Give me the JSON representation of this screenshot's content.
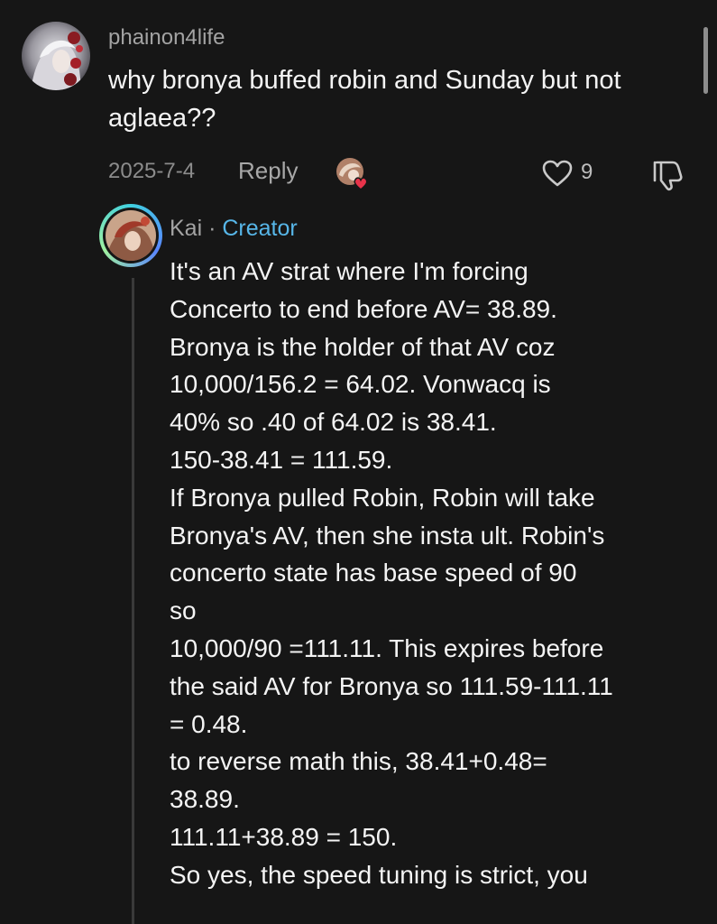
{
  "comment": {
    "username": "phainon4life",
    "text": "why bronya buffed robin and Sunday but not aglaea??",
    "date": "2025-7-4",
    "reply_label": "Reply",
    "like_count": "9"
  },
  "reply": {
    "author": "Kai",
    "separator": "·",
    "badge": "Creator",
    "lines": [
      "It's an AV strat where I'm forcing",
      "Concerto to end before AV= 38.89.",
      "Bronya is the holder of that AV coz",
      "10,000/156.2 = 64.02. Vonwacq is",
      "40% so .40 of 64.02 is 38.41.",
      "150-38.41 = 111.59.",
      "If Bronya pulled Robin, Robin will take",
      "Bronya's AV, then she insta ult. Robin's",
      "concerto state has base speed of 90",
      "so",
      "10,000/90 =111.11. This expires before",
      "the said AV for Bronya so 111.59-111.11",
      "= 0.48.",
      "to reverse math this, 38.41+0.48=",
      "38.89.",
      "111.11+38.89 = 150.",
      "So yes, the speed tuning is strict, you"
    ]
  },
  "icons": {
    "like": "heart-outline-icon",
    "dislike": "thumbs-down-outline-icon",
    "creator_liked": "heart-badge-icon"
  },
  "colors": {
    "background": "#161616",
    "creator_badge": "#57b6e8",
    "heart_badge": "#e8334a"
  }
}
